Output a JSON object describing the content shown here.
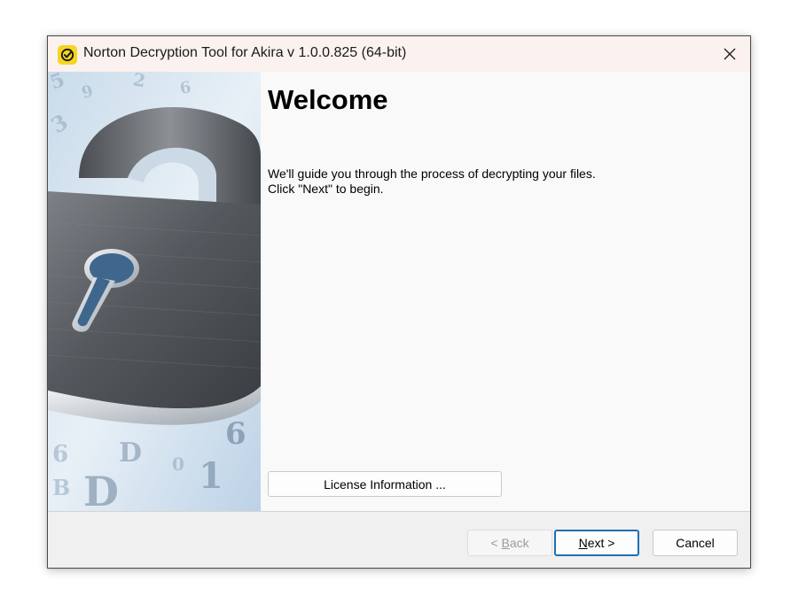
{
  "window": {
    "title": "Norton Decryption Tool for Akira v 1.0.0.825 (64-bit)",
    "app_icon": "norton-check-icon",
    "close_icon": "close-icon",
    "accent_color": "#f6d520"
  },
  "banner": {
    "image": "padlock-banner-image"
  },
  "main": {
    "heading": "Welcome",
    "description_line1": "We'll guide you through the process of decrypting your files.",
    "description_line2": "Click \"Next\" to begin.",
    "license_button_label": "License Information ..."
  },
  "footer": {
    "back_prefix": "< ",
    "back_key": "B",
    "back_rest": "ack",
    "next_key": "N",
    "next_rest": "ext >",
    "cancel_label": "Cancel"
  }
}
